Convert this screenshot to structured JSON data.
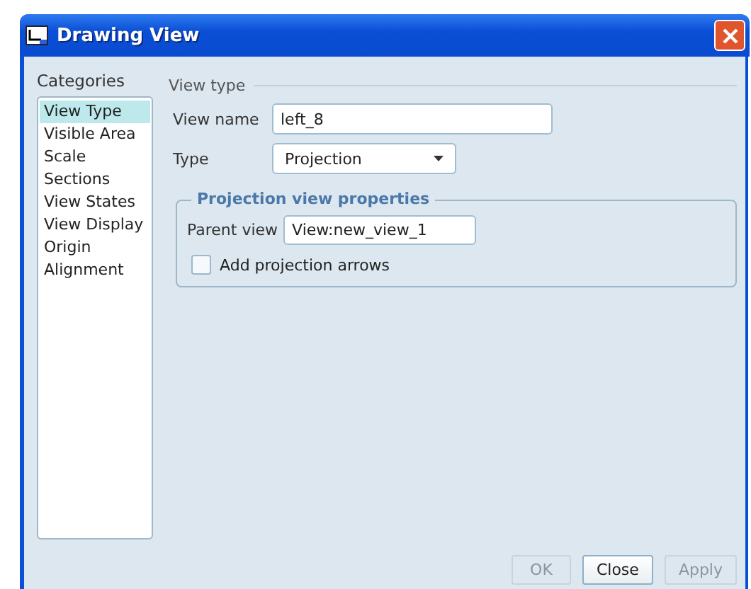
{
  "window": {
    "title": "Drawing View"
  },
  "categories": {
    "label": "Categories",
    "items": [
      {
        "label": "View Type",
        "selected": true
      },
      {
        "label": "Visible Area",
        "selected": false
      },
      {
        "label": "Scale",
        "selected": false
      },
      {
        "label": "Sections",
        "selected": false
      },
      {
        "label": "View States",
        "selected": false
      },
      {
        "label": "View Display",
        "selected": false
      },
      {
        "label": "Origin",
        "selected": false
      },
      {
        "label": "Alignment",
        "selected": false
      }
    ]
  },
  "view_type": {
    "title": "View type",
    "view_name": {
      "label": "View name",
      "value": "left_8"
    },
    "type": {
      "label": "Type",
      "value": "Projection"
    }
  },
  "projection": {
    "title": "Projection view properties",
    "parent_view": {
      "label": "Parent view",
      "value": "View:new_view_1"
    },
    "arrows": {
      "label": "Add projection arrows",
      "checked": false
    }
  },
  "buttons": [
    {
      "label": "OK",
      "disabled": true
    },
    {
      "label": "Close",
      "disabled": false
    },
    {
      "label": "Apply",
      "disabled": true
    }
  ]
}
